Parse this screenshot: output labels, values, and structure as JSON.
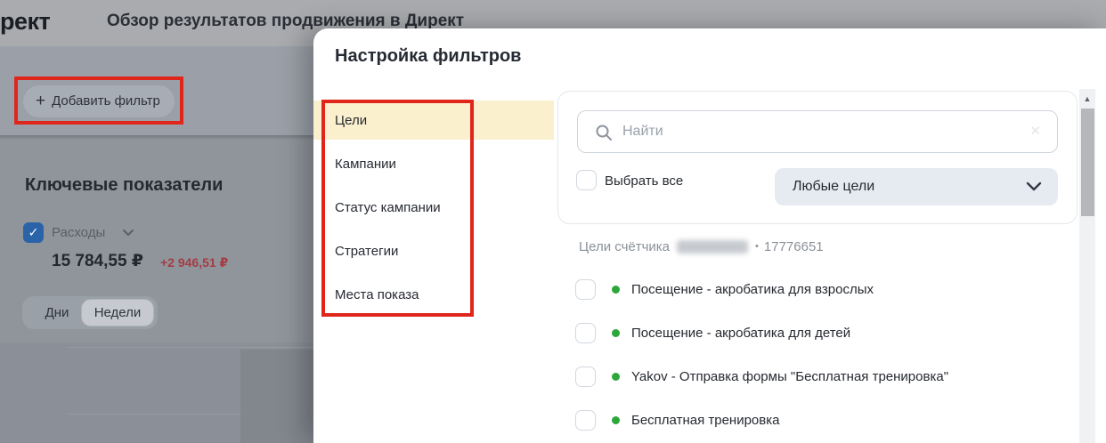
{
  "page": {
    "logo_text": "рект",
    "title": "Обзор результатов продвижения в Директ",
    "toolbar": {
      "add_filter_label": "Добавить фильтр",
      "plus_icon": "+"
    },
    "kpi": {
      "heading": "Ключевые показатели",
      "metric_label": "Расходы",
      "metric_value": "15 784,55 ₽",
      "metric_delta": "+2 946,51 ₽",
      "tabs": [
        {
          "label": "Дни",
          "selected": false
        },
        {
          "label": "Недели",
          "selected": true
        }
      ]
    }
  },
  "modal": {
    "title": "Настройка фильтров",
    "sidebar": [
      {
        "label": "Цели",
        "selected": true
      },
      {
        "label": "Кампании",
        "selected": false
      },
      {
        "label": "Статус кампании",
        "selected": false
      },
      {
        "label": "Стратегии",
        "selected": false
      },
      {
        "label": "Места показа",
        "selected": false
      }
    ],
    "search": {
      "placeholder": "Найти",
      "clear_icon": "✕"
    },
    "select_all_label": "Выбрать все",
    "goal_type_dropdown_value": "Любые цели",
    "counter": {
      "label": "Цели счётчика",
      "separator": "•",
      "id": "17776651"
    },
    "goals": [
      "Посещение - акробатика для взрослых",
      "Посещение - акробатика для детей",
      "Yakov - Отправка формы \"Бесплатная тренировка\"",
      "Бесплатная тренировка"
    ],
    "scroll_up_icon": "▲"
  },
  "colors": {
    "annotation_red": "#e0261b",
    "selected_item_yellow": "#fbf0cd",
    "goal_dot_green": "#2ca73a",
    "metric_checkbox_blue": "#2b63a8",
    "delta_red": "#a53c44",
    "dropdown_bg": "#e6eaf1"
  }
}
